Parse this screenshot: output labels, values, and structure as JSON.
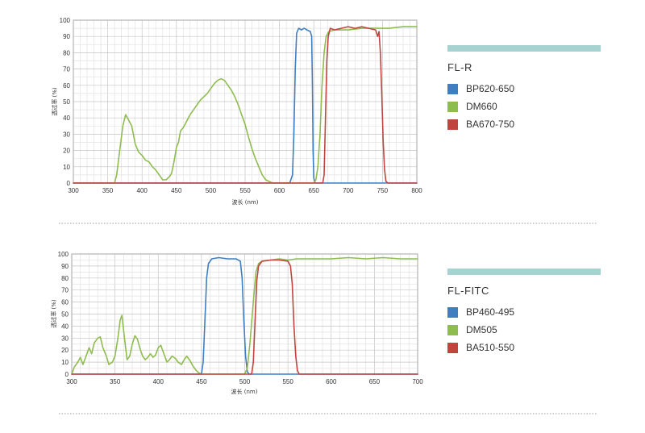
{
  "colors": {
    "blue": "#3f7fc1",
    "green": "#8fbc4f",
    "red": "#c1453f",
    "accent_bar": "#a6d3d2"
  },
  "charts": [
    {
      "legend_title": "FL-R",
      "legend": [
        {
          "label": "BP620-650",
          "color": "#3f7fc1"
        },
        {
          "label": "DM660",
          "color": "#8fbc4f"
        },
        {
          "label": "BA670-750",
          "color": "#c1453f"
        }
      ]
    },
    {
      "legend_title": "FL-FITC",
      "legend": [
        {
          "label": "BP460-495",
          "color": "#3f7fc1"
        },
        {
          "label": "DM505",
          "color": "#8fbc4f"
        },
        {
          "label": "BA510-550",
          "color": "#c1453f"
        }
      ]
    }
  ],
  "chart_data": [
    {
      "type": "line",
      "xlabel": "波长 (nm)",
      "ylabel": "透过率 (%)",
      "xlim": [
        300,
        800
      ],
      "ylim": [
        0,
        100
      ],
      "xticks": [
        300,
        350,
        400,
        450,
        500,
        550,
        600,
        650,
        700,
        750,
        800
      ],
      "yticks": [
        0,
        10,
        20,
        30,
        40,
        50,
        60,
        70,
        80,
        90,
        100
      ],
      "grid": true,
      "series": [
        {
          "name": "BP620-650",
          "color": "#3f7fc1",
          "points": [
            [
              300,
              0
            ],
            [
              615,
              0
            ],
            [
              619,
              5
            ],
            [
              621,
              30
            ],
            [
              623,
              70
            ],
            [
              625,
              92
            ],
            [
              628,
              95
            ],
            [
              632,
              94
            ],
            [
              636,
              95
            ],
            [
              640,
              94
            ],
            [
              645,
              93
            ],
            [
              647,
              90
            ],
            [
              648,
              60
            ],
            [
              649,
              20
            ],
            [
              650,
              3
            ],
            [
              652,
              0
            ],
            [
              800,
              0
            ]
          ]
        },
        {
          "name": "DM660",
          "color": "#8fbc4f",
          "points": [
            [
              300,
              0
            ],
            [
              360,
              0
            ],
            [
              363,
              5
            ],
            [
              366,
              15
            ],
            [
              369,
              25
            ],
            [
              372,
              35
            ],
            [
              376,
              42
            ],
            [
              380,
              39
            ],
            [
              385,
              35
            ],
            [
              390,
              24
            ],
            [
              395,
              19
            ],
            [
              400,
              17
            ],
            [
              405,
              14
            ],
            [
              410,
              13
            ],
            [
              415,
              10
            ],
            [
              420,
              8
            ],
            [
              425,
              5
            ],
            [
              430,
              2
            ],
            [
              435,
              2
            ],
            [
              440,
              4
            ],
            [
              443,
              6
            ],
            [
              447,
              14
            ],
            [
              450,
              22
            ],
            [
              453,
              25
            ],
            [
              456,
              32
            ],
            [
              460,
              34
            ],
            [
              465,
              38
            ],
            [
              470,
              42
            ],
            [
              475,
              45
            ],
            [
              480,
              48
            ],
            [
              485,
              51
            ],
            [
              490,
              53
            ],
            [
              495,
              55
            ],
            [
              500,
              58
            ],
            [
              505,
              61
            ],
            [
              510,
              63
            ],
            [
              515,
              64
            ],
            [
              520,
              63
            ],
            [
              525,
              60
            ],
            [
              530,
              57
            ],
            [
              535,
              53
            ],
            [
              540,
              48
            ],
            [
              545,
              42
            ],
            [
              550,
              36
            ],
            [
              555,
              28
            ],
            [
              560,
              21
            ],
            [
              565,
              15
            ],
            [
              570,
              10
            ],
            [
              575,
              5
            ],
            [
              580,
              2
            ],
            [
              585,
              1
            ],
            [
              590,
              0
            ],
            [
              650,
              0
            ],
            [
              653,
              2
            ],
            [
              656,
              10
            ],
            [
              659,
              30
            ],
            [
              662,
              60
            ],
            [
              665,
              80
            ],
            [
              668,
              90
            ],
            [
              672,
              93
            ],
            [
              680,
              94
            ],
            [
              700,
              94
            ],
            [
              720,
              95
            ],
            [
              740,
              95
            ],
            [
              760,
              95
            ],
            [
              780,
              96
            ],
            [
              800,
              96
            ]
          ]
        },
        {
          "name": "BA670-750",
          "color": "#c1453f",
          "points": [
            [
              300,
              0
            ],
            [
              663,
              0
            ],
            [
              665,
              5
            ],
            [
              667,
              40
            ],
            [
              669,
              75
            ],
            [
              671,
              90
            ],
            [
              674,
              95
            ],
            [
              680,
              94
            ],
            [
              690,
              95
            ],
            [
              700,
              96
            ],
            [
              710,
              95
            ],
            [
              720,
              96
            ],
            [
              730,
              95
            ],
            [
              740,
              94
            ],
            [
              743,
              90
            ],
            [
              745,
              93
            ],
            [
              747,
              80
            ],
            [
              749,
              55
            ],
            [
              751,
              25
            ],
            [
              753,
              8
            ],
            [
              755,
              1
            ],
            [
              758,
              0
            ],
            [
              800,
              0
            ]
          ]
        }
      ]
    },
    {
      "type": "line",
      "xlabel": "波长 (nm)",
      "ylabel": "透过率 (%)",
      "xlim": [
        300,
        700
      ],
      "ylim": [
        0,
        100
      ],
      "xticks": [
        300,
        350,
        400,
        450,
        500,
        550,
        600,
        650,
        700
      ],
      "yticks": [
        0,
        10,
        20,
        30,
        40,
        50,
        60,
        70,
        80,
        90,
        100
      ],
      "grid": true,
      "series": [
        {
          "name": "BP460-495",
          "color": "#3f7fc1",
          "points": [
            [
              300,
              0
            ],
            [
              450,
              0
            ],
            [
              452,
              10
            ],
            [
              454,
              45
            ],
            [
              456,
              80
            ],
            [
              458,
              92
            ],
            [
              462,
              96
            ],
            [
              470,
              97
            ],
            [
              480,
              96
            ],
            [
              490,
              96
            ],
            [
              495,
              94
            ],
            [
              497,
              80
            ],
            [
              499,
              45
            ],
            [
              501,
              15
            ],
            [
              503,
              2
            ],
            [
              505,
              0
            ],
            [
              700,
              0
            ]
          ]
        },
        {
          "name": "DM505",
          "color": "#8fbc4f",
          "points": [
            [
              300,
              0
            ],
            [
              303,
              6
            ],
            [
              307,
              10
            ],
            [
              310,
              14
            ],
            [
              313,
              8
            ],
            [
              316,
              14
            ],
            [
              320,
              22
            ],
            [
              323,
              17
            ],
            [
              326,
              26
            ],
            [
              330,
              30
            ],
            [
              333,
              31
            ],
            [
              336,
              22
            ],
            [
              340,
              15
            ],
            [
              343,
              8
            ],
            [
              347,
              10
            ],
            [
              350,
              15
            ],
            [
              353,
              28
            ],
            [
              356,
              45
            ],
            [
              358,
              49
            ],
            [
              361,
              30
            ],
            [
              364,
              12
            ],
            [
              367,
              15
            ],
            [
              370,
              25
            ],
            [
              373,
              32
            ],
            [
              376,
              29
            ],
            [
              379,
              21
            ],
            [
              382,
              15
            ],
            [
              385,
              12
            ],
            [
              388,
              14
            ],
            [
              391,
              17
            ],
            [
              394,
              14
            ],
            [
              397,
              16
            ],
            [
              400,
              22
            ],
            [
              403,
              24
            ],
            [
              406,
              18
            ],
            [
              410,
              10
            ],
            [
              413,
              12
            ],
            [
              416,
              15
            ],
            [
              420,
              13
            ],
            [
              423,
              10
            ],
            [
              427,
              8
            ],
            [
              430,
              12
            ],
            [
              433,
              15
            ],
            [
              437,
              11
            ],
            [
              440,
              7
            ],
            [
              444,
              3
            ],
            [
              447,
              1
            ],
            [
              450,
              0
            ],
            [
              500,
              0
            ],
            [
              503,
              5
            ],
            [
              506,
              25
            ],
            [
              510,
              60
            ],
            [
              513,
              85
            ],
            [
              516,
              92
            ],
            [
              520,
              94
            ],
            [
              530,
              95
            ],
            [
              540,
              96
            ],
            [
              550,
              95
            ],
            [
              560,
              96
            ],
            [
              580,
              96
            ],
            [
              600,
              96
            ],
            [
              620,
              97
            ],
            [
              640,
              96
            ],
            [
              660,
              97
            ],
            [
              680,
              96
            ],
            [
              700,
              96
            ]
          ]
        },
        {
          "name": "BA510-550",
          "color": "#c1453f",
          "points": [
            [
              300,
              0
            ],
            [
              508,
              0
            ],
            [
              510,
              10
            ],
            [
              512,
              45
            ],
            [
              514,
              78
            ],
            [
              516,
              90
            ],
            [
              520,
              94
            ],
            [
              530,
              95
            ],
            [
              540,
              95
            ],
            [
              550,
              94
            ],
            [
              553,
              90
            ],
            [
              555,
              75
            ],
            [
              557,
              40
            ],
            [
              559,
              15
            ],
            [
              561,
              3
            ],
            [
              563,
              0
            ],
            [
              700,
              0
            ]
          ]
        }
      ]
    }
  ]
}
